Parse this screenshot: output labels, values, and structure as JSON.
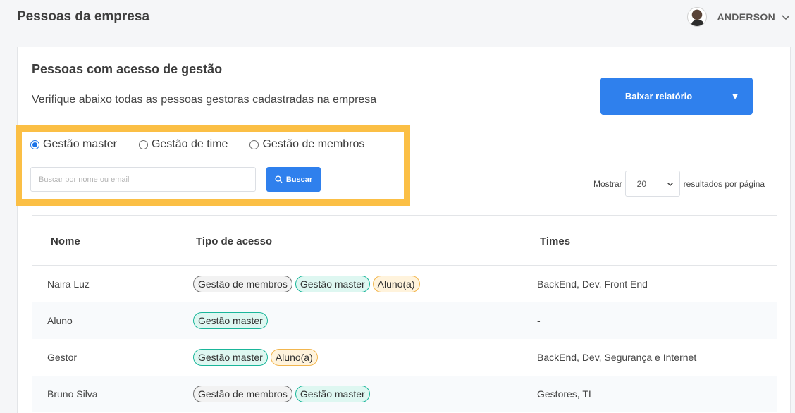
{
  "header": {
    "title": "Pessoas da empresa",
    "user_name": "ANDERSON"
  },
  "card": {
    "title": "Pessoas com acesso de gestão",
    "description": "Verifique abaixo todas as pessoas gestoras cadastradas na empresa",
    "report_button": "Baixar relatório",
    "report_caret": "▼"
  },
  "filters": {
    "options": [
      {
        "label": "Gestão master",
        "checked": true
      },
      {
        "label": "Gestão de time",
        "checked": false
      },
      {
        "label": "Gestão de membros",
        "checked": false
      }
    ],
    "search_placeholder": "Buscar por nome ou email",
    "search_value": "",
    "search_button": "Buscar"
  },
  "pagination": {
    "prefix": "Mostrar",
    "per_page": "20",
    "suffix": "resultados por página"
  },
  "table": {
    "columns": [
      "Nome",
      "Tipo de acesso",
      "Times"
    ],
    "rows": [
      {
        "name": "Naira Luz",
        "badges": [
          {
            "label": "Gestão de membros",
            "kind": "membros"
          },
          {
            "label": "Gestão master",
            "kind": "master"
          },
          {
            "label": "Aluno(a)",
            "kind": "aluno"
          }
        ],
        "teams": "BackEnd, Dev, Front End"
      },
      {
        "name": "Aluno",
        "badges": [
          {
            "label": "Gestão master",
            "kind": "master"
          }
        ],
        "teams": "-"
      },
      {
        "name": "Gestor",
        "badges": [
          {
            "label": "Gestão master",
            "kind": "master"
          },
          {
            "label": "Aluno(a)",
            "kind": "aluno"
          }
        ],
        "teams": "BackEnd, Dev, Segurança e Internet"
      },
      {
        "name": "Bruno Silva",
        "badges": [
          {
            "label": "Gestão de membros",
            "kind": "membros"
          },
          {
            "label": "Gestão master",
            "kind": "master"
          }
        ],
        "teams": "Gestores, TI"
      }
    ]
  },
  "colors": {
    "accent": "#2f80ed",
    "highlight_border": "#fbbf45",
    "badge_master_border": "#1ab69a",
    "badge_aluno_border": "#f2b64e",
    "badge_membros_border": "#6e6e6e"
  }
}
